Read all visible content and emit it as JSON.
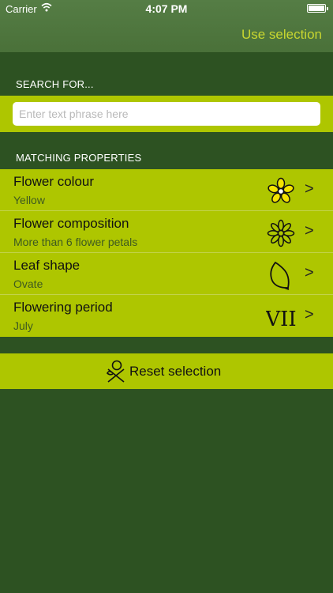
{
  "status": {
    "carrier": "Carrier",
    "time": "4:07 PM"
  },
  "nav": {
    "use_selection": "Use selection"
  },
  "search": {
    "header": "SEARCH FOR...",
    "placeholder": "Enter text phrase here",
    "value": ""
  },
  "properties": {
    "header": "MATCHING PROPERTIES",
    "items": [
      {
        "title": "Flower colour",
        "value": "Yellow",
        "icon": "yellow-flower-icon"
      },
      {
        "title": "Flower composition",
        "value": "More than 6 flower petals",
        "icon": "many-petals-flower-icon"
      },
      {
        "title": "Leaf shape",
        "value": "Ovate",
        "icon": "ovate-leaf-icon"
      },
      {
        "title": "Flowering period",
        "value": "July",
        "icon": "roman-numeral-vii-icon",
        "icon_text": "VII"
      }
    ],
    "chevron": ">"
  },
  "reset": {
    "label": "Reset selection",
    "icon": "reset-flower-icon"
  },
  "colors": {
    "background": "#2d5222",
    "navbar": "#4f763f",
    "accent": "#aec600",
    "nav_action": "#c8d630"
  }
}
